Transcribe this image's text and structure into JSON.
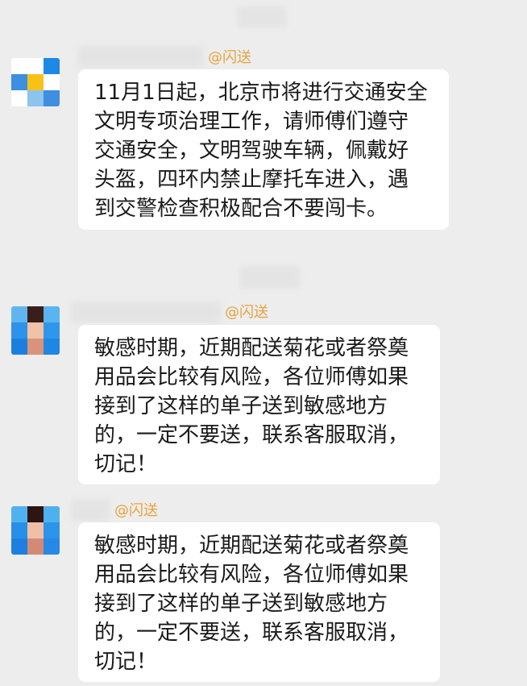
{
  "messages": [
    {
      "mention": "@闪送",
      "text": "11月1日起，北京市将进行交通安全\n文明专项治理工作，请师傅们遵守\n交通安全，文明驾驶车辆，佩戴好\n头盔，四环内禁止摩托车进入，遇\n到交警检查积极配合不要闯卡。",
      "avatar_colors": [
        "#ffffff",
        "#ffffff",
        "#1e88e5",
        "#3d8fe0",
        "#f8c11a",
        "#ffffff",
        "#ffffff",
        "#8cc4ef",
        "#3d8fe0"
      ]
    },
    {
      "mention": "@闪送",
      "text": "敏感时期，近期配送菊花或者祭奠\n用品会比较有风险，各位师傅如果\n接到了这样的单子送到敏感地方\n的，一定不要送，联系客服取消，\n切记！",
      "avatar_colors": [
        "#5fb6ee",
        "#3a1e1a",
        "#59b4ef",
        "#2d93e8",
        "#f0c2a6",
        "#2f97ea",
        "#1c7fe0",
        "#d9937a",
        "#1f86e4"
      ]
    },
    {
      "mention": "@闪送",
      "text": "敏感时期，近期配送菊花或者祭奠\n用品会比较有风险，各位师傅如果\n接到了这样的单子送到敏感地方\n的，一定不要送，联系客服取消，\n切记！",
      "avatar_colors": [
        "#4fb2ef",
        "#2e1512",
        "#4fb0ee",
        "#2690e8",
        "#efc0a5",
        "#2d94e9",
        "#1d80e0",
        "#d38a75",
        "#2888e6"
      ]
    }
  ],
  "theme": {
    "background": "#ededed",
    "bubble": "#ffffff",
    "mention_color": "#e8a33d",
    "text_color": "#1a1a1a"
  }
}
